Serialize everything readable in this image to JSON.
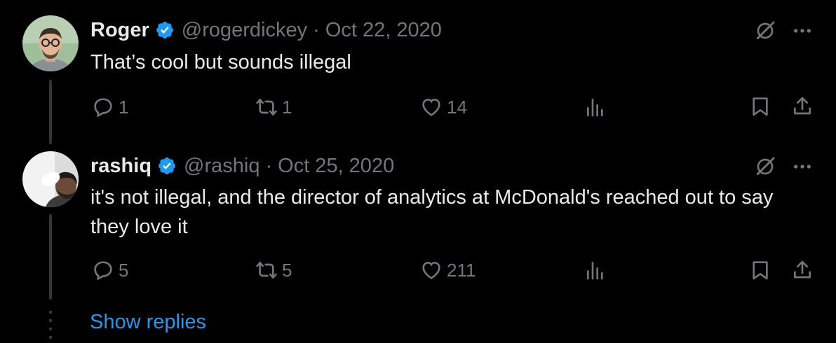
{
  "tweets": [
    {
      "display_name": "Roger",
      "handle": "@rogerdickey",
      "separator": "·",
      "date": "Oct 22, 2020",
      "text": "That’s cool but sounds illegal",
      "replies": "1",
      "retweets": "1",
      "likes": "14"
    },
    {
      "display_name": "rashiq",
      "handle": "@rashiq",
      "separator": "·",
      "date": "Oct 25, 2020",
      "text": "it's not illegal, and the director of analytics at McDonald's reached out to say they love it",
      "replies": "5",
      "retweets": "5",
      "likes": "211"
    }
  ],
  "show_replies_label": "Show replies",
  "colors": {
    "background": "#000000",
    "text": "#e7e9ea",
    "muted": "#71767b",
    "accent": "#1d9bf0",
    "thread_line": "#333639"
  },
  "icons": [
    "verified-badge-icon",
    "grok-icon",
    "more-icon",
    "reply-icon",
    "retweet-icon",
    "like-icon",
    "views-icon",
    "bookmark-icon",
    "share-icon"
  ]
}
